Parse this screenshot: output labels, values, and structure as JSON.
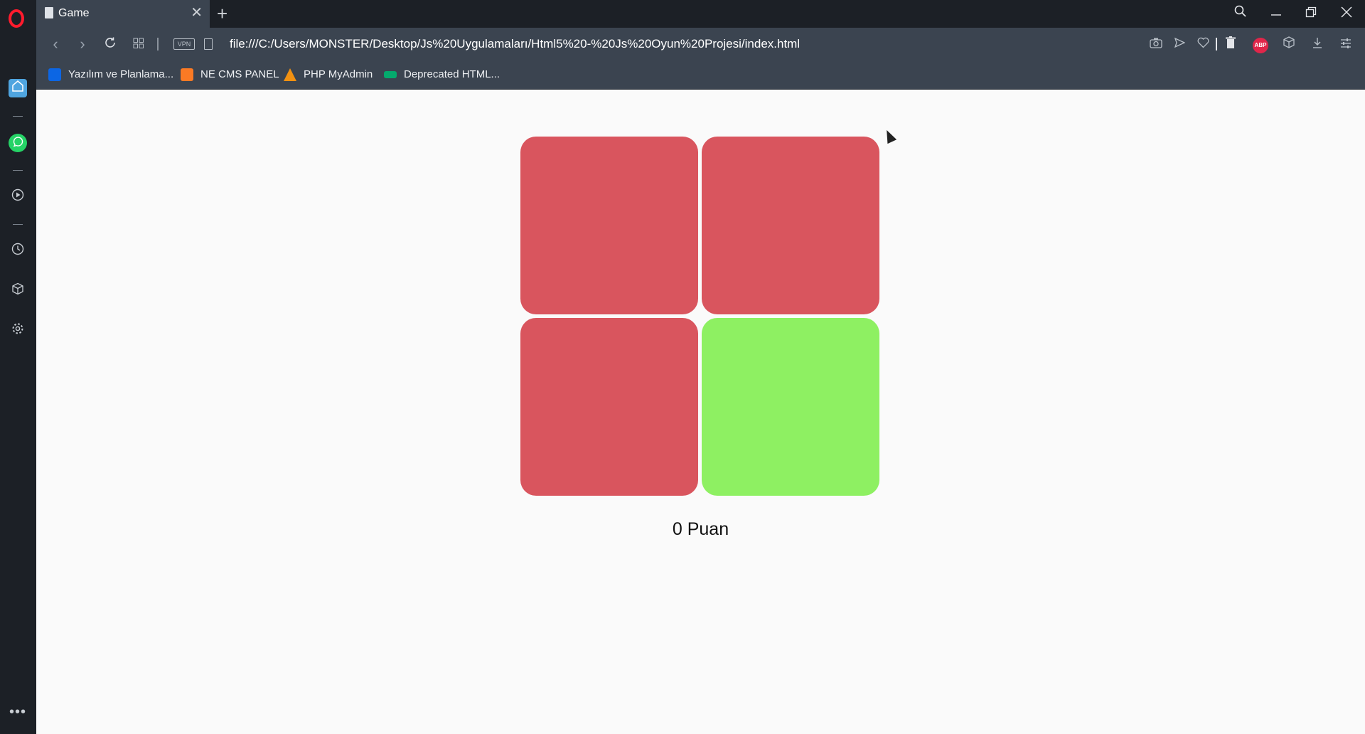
{
  "browser": {
    "tab": {
      "title": "Game"
    },
    "address": {
      "vpn_label": "VPN",
      "url": "file:///C:/Users/MONSTER/Desktop/Js%20Uygulamaları/Html5%20-%20Js%20Oyun%20Projesi/index.html"
    },
    "extensions": {
      "abp_label": "ABP"
    },
    "bookmarks": [
      {
        "label": "Yazılım ve Planlama...",
        "icon": "trello-icon",
        "color": "#0c66e4"
      },
      {
        "label": "NE CMS PANEL",
        "icon": "xampp-icon",
        "color": "#fb7a24"
      },
      {
        "label": "PHP MyAdmin",
        "icon": "phpmyadmin-icon",
        "color": "#f29111"
      },
      {
        "label": "Deprecated HTML...",
        "icon": "w3-icon",
        "color": "#04aa6d"
      }
    ]
  },
  "game": {
    "tiles": [
      {
        "color": "#d9555e",
        "state": "red"
      },
      {
        "color": "#d9555e",
        "state": "red"
      },
      {
        "color": "#d9555e",
        "state": "red"
      },
      {
        "color": "#8ef062",
        "state": "green"
      }
    ],
    "score_text": "0 Puan"
  },
  "colors": {
    "tile_red": "#d9555e",
    "tile_green": "#8ef062",
    "chrome_dark": "#1c2026",
    "chrome_mid": "#3b4450"
  }
}
